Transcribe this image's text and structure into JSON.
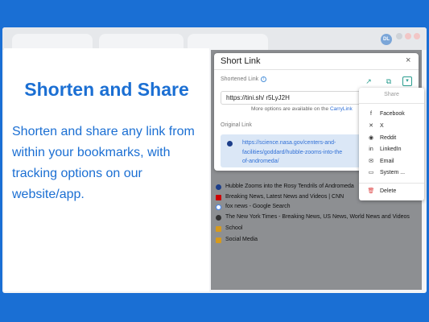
{
  "promo": {
    "headline": "Shorten and Share",
    "description": "Shorten and share any link from within your bookmarks, with tracking options on our website/app."
  },
  "browser": {
    "avatar_initials": "DL"
  },
  "dialog": {
    "title": "Short Link",
    "close_icon": "×",
    "shortened_label": "Shortened Link",
    "info_icon": "i",
    "short_url": "https://tini.sh/ r5LyJ2H",
    "more_options_text": "More options are available on the",
    "more_options_link": "CarryLink",
    "original_label": "Original Link",
    "original_url": "https://science.nasa.gov/centers-and-facilities/goddard/hubble-zooms-into-the-rosy-tendrils-of-andromeda/",
    "original_url_line1": "https://science.nasa.gov/centers-and-",
    "original_url_line2": "facilities/goddard/hubble-zooms-into-the",
    "original_url_line3": "of-andromeda/",
    "icons": {
      "open": "↗",
      "copy": "⧉",
      "menu": "▾"
    }
  },
  "share_menu": {
    "header": "Share",
    "items": [
      {
        "label": "Facebook",
        "icon": "f"
      },
      {
        "label": "X",
        "icon": "✕"
      },
      {
        "label": "Reddit",
        "icon": "◉"
      },
      {
        "label": "LinkedIn",
        "icon": "in"
      },
      {
        "label": "Email",
        "icon": "✉"
      },
      {
        "label": "System ...",
        "icon": "▭"
      }
    ],
    "delete": {
      "label": "Delete",
      "icon": "🗑"
    }
  },
  "bookmarks": [
    {
      "title": "Hubble Zooms into the Rosy Tendrils of Andromeda",
      "type": "nasa"
    },
    {
      "title": "Breaking News, Latest News and Videos | CNN",
      "type": "cnn"
    },
    {
      "title": "fox news - Google Search",
      "type": "google"
    },
    {
      "title": "The New York Times - Breaking News, US News, World News and Videos",
      "type": "nyt"
    },
    {
      "title": "School",
      "type": "folder"
    },
    {
      "title": "Social Media",
      "type": "folder"
    }
  ],
  "colors": {
    "background": "#1a6fd4",
    "accent_text": "#1b6fd3",
    "link": "#2f6fd6",
    "icon_teal": "#2a9d8f"
  }
}
